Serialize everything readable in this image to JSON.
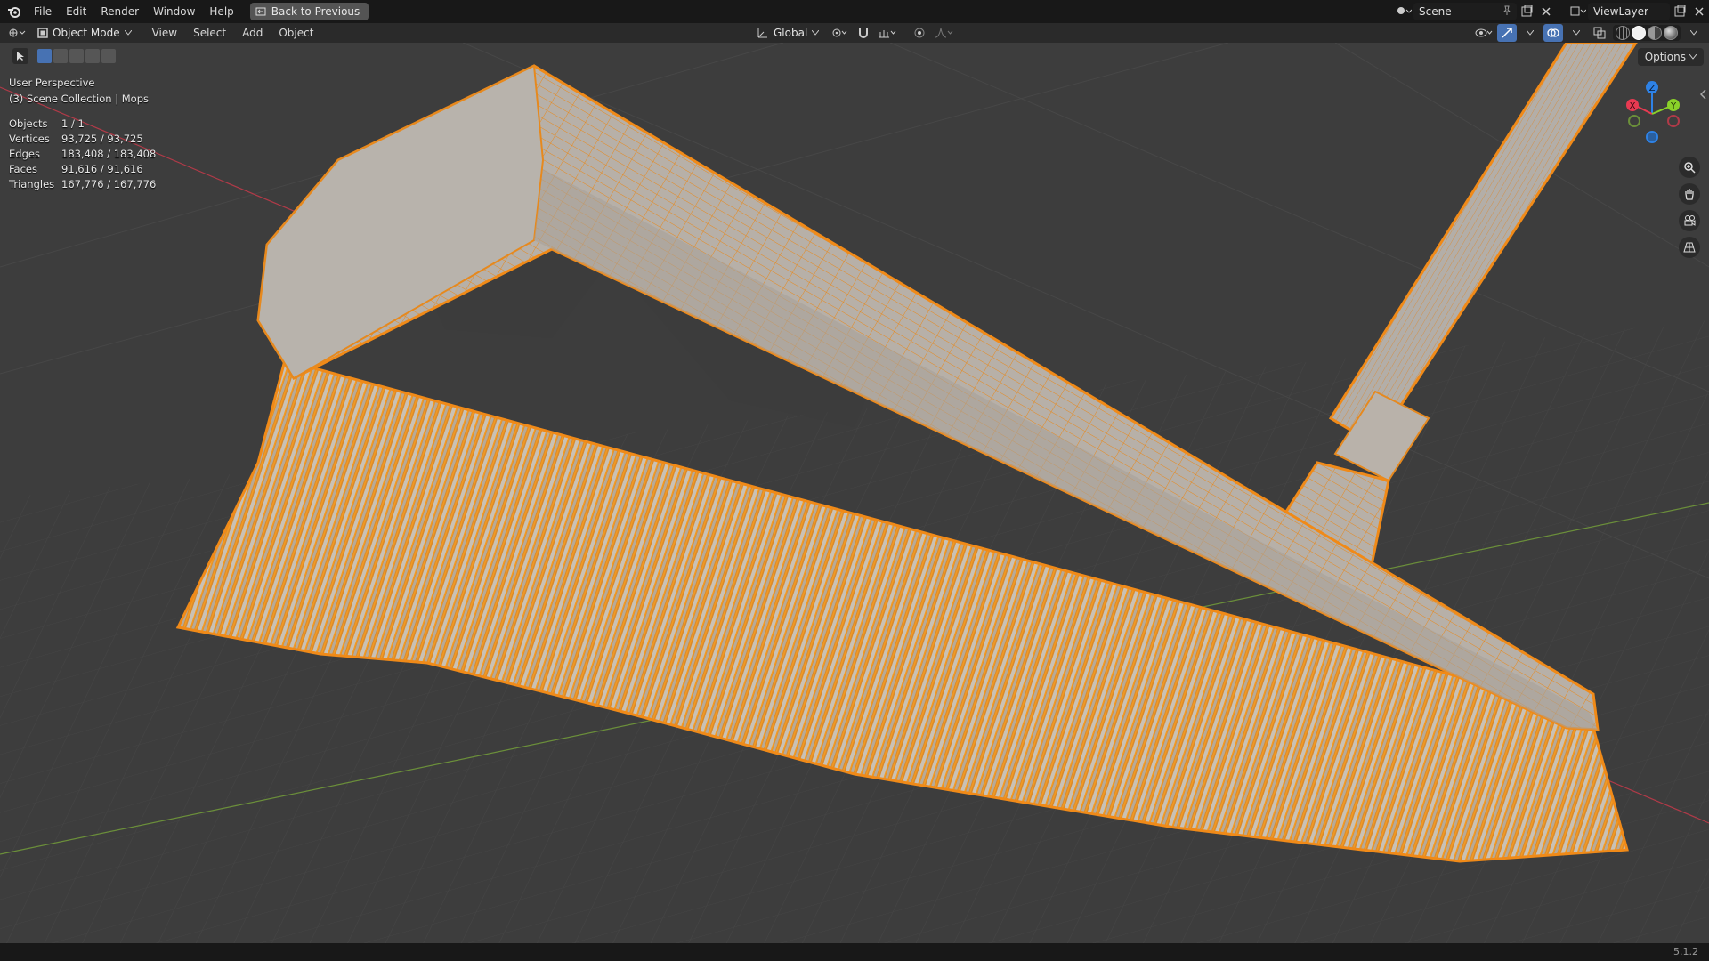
{
  "topbar": {
    "menus": [
      "File",
      "Edit",
      "Render",
      "Window",
      "Help"
    ],
    "back_button": "Back to Previous",
    "scene": "Scene",
    "view_layer": "ViewLayer"
  },
  "header": {
    "mode": "Object Mode",
    "menus": [
      "View",
      "Select",
      "Add",
      "Object"
    ],
    "transform_orientation": "Global"
  },
  "viewport": {
    "perspective": "User Perspective",
    "collection": "(3) Scene Collection | Mops",
    "options": "Options",
    "stats": [
      {
        "label": "Objects",
        "value": "1 / 1"
      },
      {
        "label": "Vertices",
        "value": "93,725 / 93,725"
      },
      {
        "label": "Edges",
        "value": "183,408 / 183,408"
      },
      {
        "label": "Faces",
        "value": "91,616 / 91,616"
      },
      {
        "label": "Triangles",
        "value": "167,776 / 167,776"
      }
    ],
    "gizmo": {
      "x": "X",
      "y": "Y",
      "z": "Z"
    },
    "colors": {
      "selection": "#e6891e",
      "x_axis": "#e83a52",
      "y_axis": "#8ad129",
      "z_axis": "#2e82e6"
    }
  },
  "status": {
    "version": "5.1.2"
  }
}
